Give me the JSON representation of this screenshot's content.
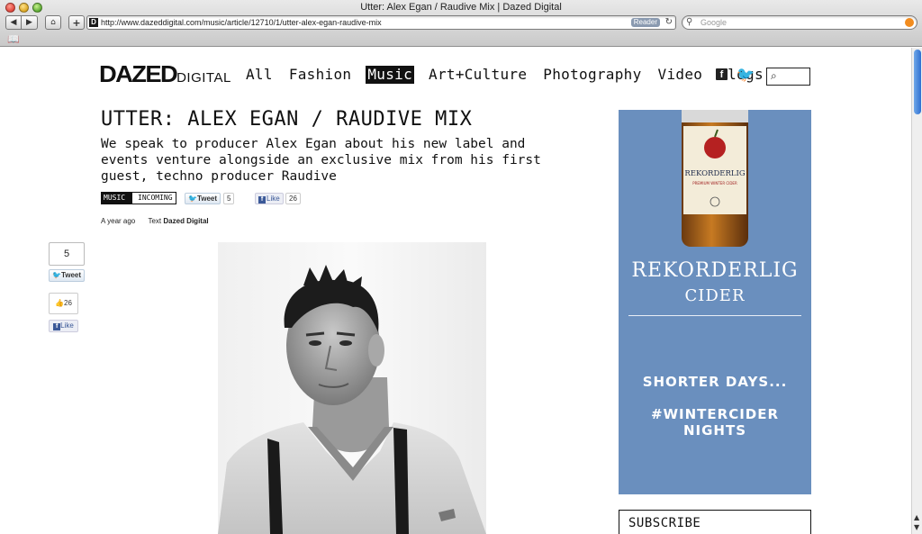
{
  "browser": {
    "window_title": "Utter: Alex Egan / Raudive Mix | Dazed Digital",
    "url": "http://www.dazeddigital.com/music/article/12710/1/utter-alex-egan-raudive-mix",
    "reader_label": "Reader",
    "search_placeholder": "Google",
    "favicon_letter": "D"
  },
  "site": {
    "logo_main": "DAZED",
    "logo_sub": "DIGITAL",
    "nav": [
      "All",
      "Fashion",
      "Music",
      "Art+Culture",
      "Photography",
      "Video",
      "Blogs"
    ],
    "active_nav": "Music"
  },
  "article": {
    "title": "UTTER: ALEX EGAN / RAUDIVE MIX",
    "standfirst": "We speak to producer Alex Egan about his new label and events venture alongside an exclusive mix from his first guest, techno producer Raudive",
    "tags": [
      "MUSIC",
      "INCOMING"
    ],
    "tweet_label": "Tweet",
    "tweet_count": "5",
    "like_label": "Like",
    "like_count": "26",
    "published": "A year ago",
    "credit_prefix": "Text",
    "credit_name": "Dazed Digital"
  },
  "share_sidebar": {
    "tweet_count": "5",
    "tweet_label": "Tweet",
    "like_count": "26",
    "like_label": "Like"
  },
  "ad": {
    "bottle_brand": "REKORDERLIG",
    "bottle_subline": "PREMIUM WINTER CIDER",
    "brand": "REKORDERLIG",
    "product": "CIDER",
    "line1": "SHORTER DAYS...",
    "line2": "#WINTERCIDER NIGHTS",
    "background_color": "#6a8fbe"
  },
  "subscribe_label": "SUBSCRIBE"
}
